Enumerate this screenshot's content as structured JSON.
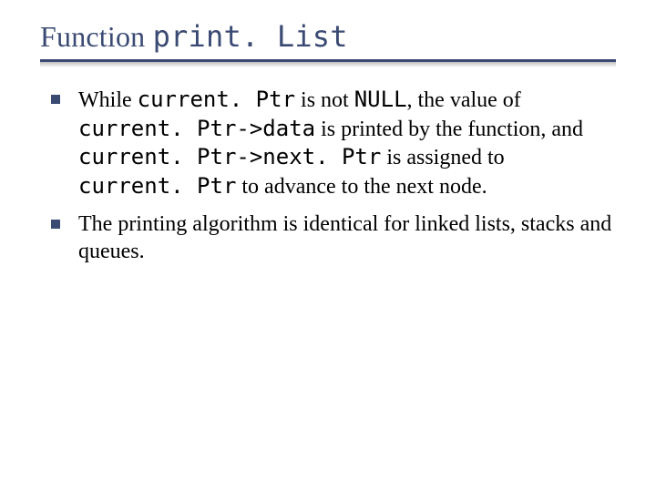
{
  "title": {
    "prefix": "Function ",
    "code": "print. List"
  },
  "bullets": [
    {
      "segments": [
        {
          "t": "While ",
          "mono": false
        },
        {
          "t": "current. Ptr",
          "mono": true
        },
        {
          "t": " is not ",
          "mono": false
        },
        {
          "t": "NULL",
          "mono": true
        },
        {
          "t": ", the value of ",
          "mono": false
        },
        {
          "t": "current. Ptr->data",
          "mono": true
        },
        {
          "t": " is printed by the function, and ",
          "mono": false
        },
        {
          "t": "current. Ptr->next. Ptr",
          "mono": true
        },
        {
          "t": " is assigned to ",
          "mono": false
        },
        {
          "t": "current. Ptr",
          "mono": true
        },
        {
          "t": " to advance to the next node.",
          "mono": false
        }
      ]
    },
    {
      "segments": [
        {
          "t": "The printing algorithm is identical for linked lists, stacks and queues.",
          "mono": false
        }
      ]
    }
  ]
}
